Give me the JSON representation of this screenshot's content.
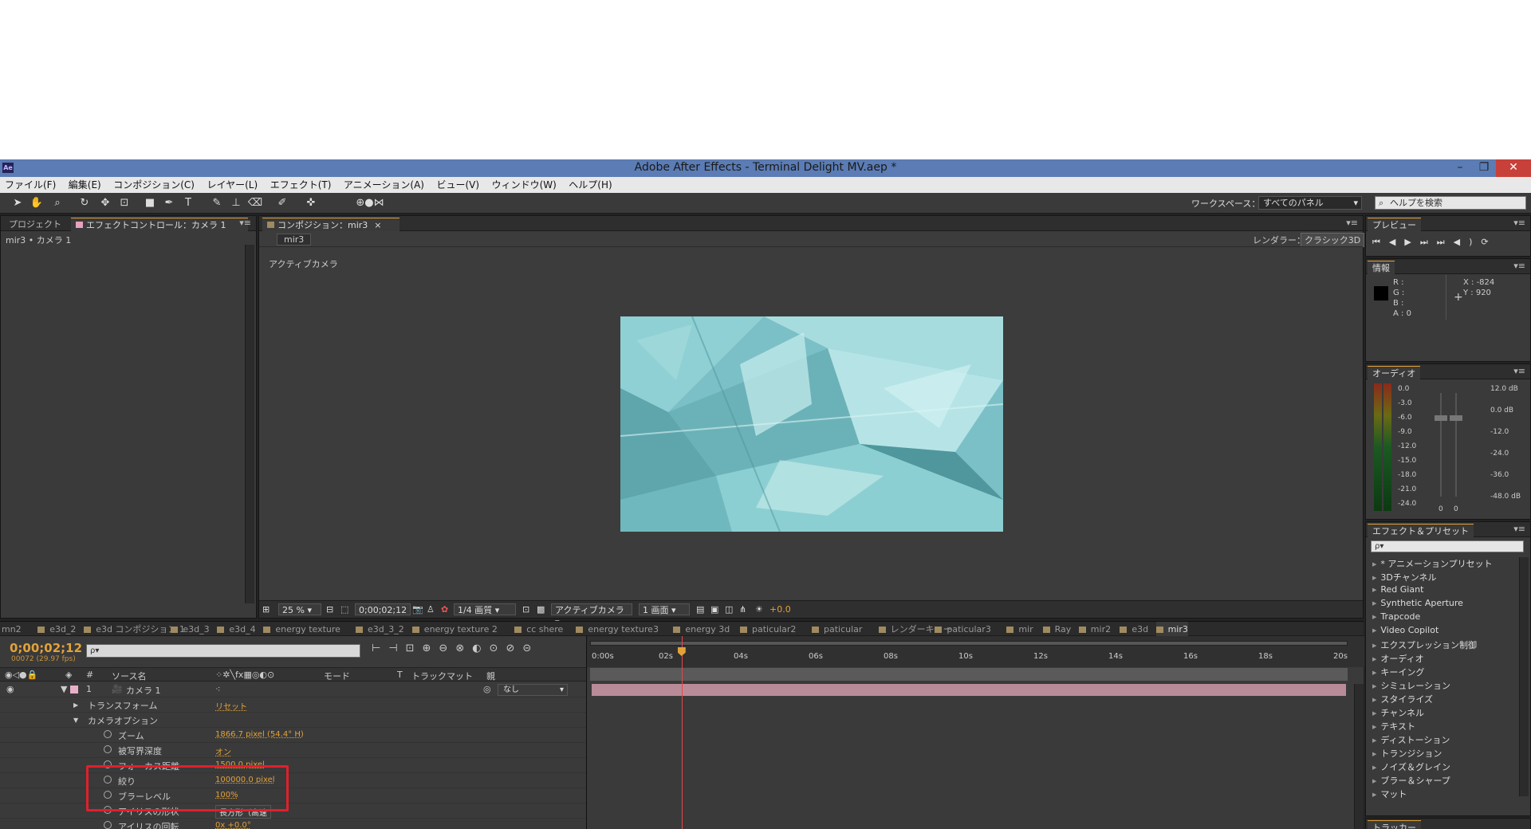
{
  "app": {
    "icon": "Ae",
    "title": "Adobe After Effects - Terminal Delight MV.aep *",
    "window_buttons": [
      "–",
      "❐",
      "✕"
    ]
  },
  "menu": [
    "ファイル(F)",
    "編集(E)",
    "コンポジション(C)",
    "レイヤー(L)",
    "エフェクト(T)",
    "アニメーション(A)",
    "ビュー(V)",
    "ウィンドウ(W)",
    "ヘルプ(H)"
  ],
  "toolbar": {
    "workspace_label": "ワークスペース：",
    "workspace_value": "すべてのパネル",
    "help_placeholder": "ヘルプを検索"
  },
  "project_panel": {
    "tab_project": "プロジェクト",
    "tab_effect_controls": "エフェクトコントロール：カメラ 1",
    "breadcrumb": "mir3 • カメラ 1"
  },
  "composition_panel": {
    "tab": "コンポジション：mir3",
    "comp_button": "mir3",
    "renderer_label": "レンダラー：",
    "renderer_value": "クラシック3D",
    "active_camera_label": "アクティブカメラ",
    "zoom": "25 %",
    "timecode": "0;00;02;12",
    "resolution": "1/4 画質",
    "view": "アクティブカメラ",
    "layout": "1 画面",
    "exposure": "+0.0"
  },
  "timeline_tabs": [
    {
      "label": "mn2",
      "active": false
    },
    {
      "label": "e3d_2",
      "active": false
    },
    {
      "label": "e3d コンポジション 1",
      "active": false
    },
    {
      "label": "e3d_3",
      "active": false
    },
    {
      "label": "e3d_4",
      "active": false
    },
    {
      "label": "energy texture",
      "active": false
    },
    {
      "label": "e3d_3_2",
      "active": false
    },
    {
      "label": "energy texture 2",
      "active": false
    },
    {
      "label": "cc shere",
      "active": false
    },
    {
      "label": "energy texture3",
      "active": false
    },
    {
      "label": "energy 3d",
      "active": false
    },
    {
      "label": "paticular2",
      "active": false
    },
    {
      "label": "paticular",
      "active": false
    },
    {
      "label": "レンダーキュー",
      "active": false
    },
    {
      "label": "paticular3",
      "active": false
    },
    {
      "label": "mir",
      "active": false
    },
    {
      "label": "Ray",
      "active": false
    },
    {
      "label": "mir2",
      "active": false
    },
    {
      "label": "e3d",
      "active": false
    },
    {
      "label": "mir3",
      "active": true
    }
  ],
  "timeline": {
    "current_time": "0;00;02;12",
    "frame_info": "00072 (29.97 fps)",
    "search_placeholder": "ρ▾",
    "headers": {
      "num": "#",
      "source": "ソース名",
      "mode": "モード",
      "t": "T",
      "trackmatte": "トラックマット",
      "parent": "親"
    },
    "layer": {
      "num": "1",
      "name": "カメラ 1",
      "parent": "なし"
    },
    "properties": [
      {
        "name": "トランスフォーム",
        "value": "リセット",
        "indent": 1
      },
      {
        "name": "カメラオプション",
        "value": "",
        "indent": 1
      },
      {
        "name": "ズーム",
        "value": "1866.7 pixel (54.4° H)",
        "indent": 2
      },
      {
        "name": "被写界深度",
        "value": "オン",
        "indent": 2
      },
      {
        "name": "フォーカス距離",
        "value": "1500.0 pixel",
        "indent": 2
      },
      {
        "name": "絞り",
        "value": "100000.0 pixel",
        "indent": 2
      },
      {
        "name": "ブラーレベル",
        "value": "100%",
        "indent": 2
      },
      {
        "name": "アイリスの形状",
        "value": "長方形（高速",
        "indent": 2
      },
      {
        "name": "アイリスの回転",
        "value": "0x +0.0°",
        "indent": 2
      }
    ],
    "ruler": [
      "0:00s",
      "02s",
      "04s",
      "06s",
      "08s",
      "10s",
      "12s",
      "14s",
      "16s",
      "18s",
      "20s"
    ],
    "playhead_seconds": 2.4,
    "duration_seconds": 20
  },
  "preview_panel": {
    "tab": "プレビュー"
  },
  "info_panel": {
    "tab": "情報",
    "r": "R :",
    "g": "G :",
    "b": "B :",
    "a": "A : 0",
    "x": "X : -824",
    "y": "Y : 920"
  },
  "audio_panel": {
    "tab": "オーディオ",
    "left_scale": [
      "0.0",
      "-3.0",
      "-6.0",
      "-9.0",
      "-12.0",
      "-15.0",
      "-18.0",
      "-21.0",
      "-24.0"
    ],
    "right_scale": [
      "12.0 dB",
      "0.0 dB",
      "-12.0",
      "-24.0",
      "-36.0",
      "-48.0 dB"
    ],
    "slider_values": [
      "0",
      "0"
    ]
  },
  "effects_panel": {
    "tab": "エフェクト＆プリセット",
    "search_placeholder": "ρ▾",
    "items": [
      "* アニメーションプリセット",
      "3Dチャンネル",
      "Red Giant",
      "Synthetic Aperture",
      "Trapcode",
      "Video Copilot",
      "エクスプレッション制御",
      "オーディオ",
      "キーイング",
      "シミュレーション",
      "スタイライズ",
      "チャンネル",
      "テキスト",
      "ディストーション",
      "トランジション",
      "ノイズ＆グレイン",
      "ブラー＆シャープ",
      "マット"
    ]
  },
  "tracker_panel": {
    "tab": "トラッカー"
  },
  "colors": {
    "accent": "#e2a23a",
    "layer_bar": "#b98b98",
    "highlight_box": "#e0202a",
    "title_bar": "#5b7cb4"
  }
}
